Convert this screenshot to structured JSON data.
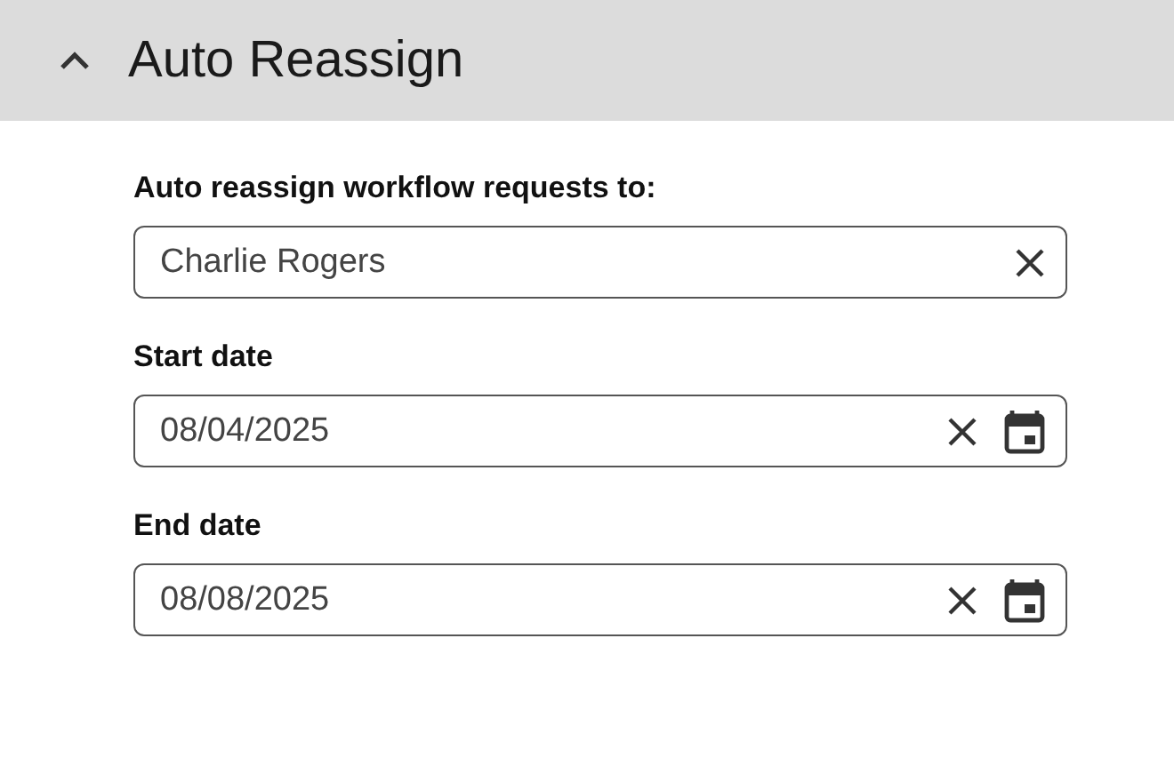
{
  "section": {
    "title": "Auto Reassign",
    "expanded": true
  },
  "fields": [
    {
      "kind": "text",
      "label": "Auto reassign workflow requests to:",
      "value": "Charlie Rogers"
    },
    {
      "kind": "date",
      "label": "Start date",
      "value": "08/04/2025"
    },
    {
      "kind": "date",
      "label": "End date",
      "value": "08/08/2025"
    }
  ]
}
